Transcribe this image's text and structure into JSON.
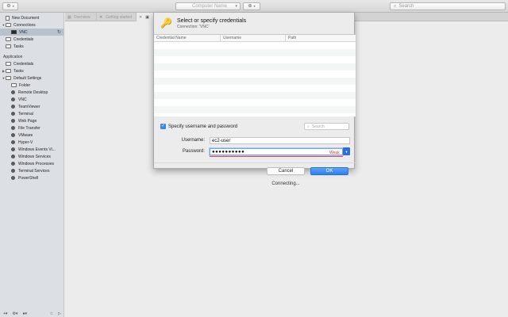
{
  "toolbar": {
    "computer_placeholder": "Computer Name",
    "search_placeholder": "Search"
  },
  "sidebar": {
    "items": [
      {
        "label": "New Document",
        "kind": "doc",
        "indent": 1,
        "tri": ""
      },
      {
        "label": "Connections",
        "kind": "folder",
        "indent": 1,
        "tri": "▼"
      },
      {
        "label": "VNC",
        "kind": "monitor",
        "indent": 2,
        "tri": "",
        "selected": true
      },
      {
        "label": "Credentials",
        "kind": "folder",
        "indent": 1,
        "tri": ""
      },
      {
        "label": "Tasks",
        "kind": "folder",
        "indent": 1,
        "tri": ""
      },
      {
        "label": "Application",
        "kind": "header",
        "indent": 0,
        "tri": ""
      },
      {
        "label": "Credentials",
        "kind": "folder",
        "indent": 1,
        "tri": ""
      },
      {
        "label": "Tasks",
        "kind": "folder",
        "indent": 1,
        "tri": "▶"
      },
      {
        "label": "Default Settings",
        "kind": "folder",
        "indent": 1,
        "tri": "▼"
      },
      {
        "label": "Folder",
        "kind": "folder",
        "indent": 2,
        "tri": ""
      },
      {
        "label": "Remote Desktop",
        "kind": "globe",
        "indent": 2,
        "tri": ""
      },
      {
        "label": "VNC",
        "kind": "globe",
        "indent": 2,
        "tri": ""
      },
      {
        "label": "TeamViewer",
        "kind": "globe",
        "indent": 2,
        "tri": ""
      },
      {
        "label": "Terminal",
        "kind": "globe",
        "indent": 2,
        "tri": ""
      },
      {
        "label": "Web Page",
        "kind": "globe",
        "indent": 2,
        "tri": ""
      },
      {
        "label": "File Transfer",
        "kind": "globe",
        "indent": 2,
        "tri": ""
      },
      {
        "label": "VMware",
        "kind": "globe",
        "indent": 2,
        "tri": ""
      },
      {
        "label": "Hyper-V",
        "kind": "globe",
        "indent": 2,
        "tri": ""
      },
      {
        "label": "Windows Events Vi...",
        "kind": "globe",
        "indent": 2,
        "tri": ""
      },
      {
        "label": "Windows Services",
        "kind": "globe",
        "indent": 2,
        "tri": ""
      },
      {
        "label": "Windows Processes",
        "kind": "globe",
        "indent": 2,
        "tri": ""
      },
      {
        "label": "Terminal Services",
        "kind": "globe",
        "indent": 2,
        "tri": ""
      },
      {
        "label": "PowerShell",
        "kind": "globe",
        "indent": 2,
        "tri": ""
      }
    ]
  },
  "tabs": [
    {
      "label": "Overview"
    },
    {
      "label": "Getting started"
    },
    {
      "label": ""
    }
  ],
  "dialog": {
    "title": "Select or specify credentials",
    "subtitle": "Connection: 'VNC'",
    "columns": [
      "Credential Name",
      "Username",
      "Path"
    ],
    "specify_label": "Specify username and password",
    "search_placeholder": "Search",
    "username_label": "Username:",
    "username_value": "ec2-user",
    "password_label": "Password:",
    "password_value": "●●●●●●●●●●",
    "strength": "Weak",
    "cancel": "Cancel",
    "ok": "OK"
  },
  "status": {
    "connecting": "Connecting..."
  },
  "colors": {
    "accent": "#2f7ef0",
    "weak": "#d33333",
    "sidebar_bg": "#dce0e5",
    "selected_bg": "#b8c2cd"
  }
}
